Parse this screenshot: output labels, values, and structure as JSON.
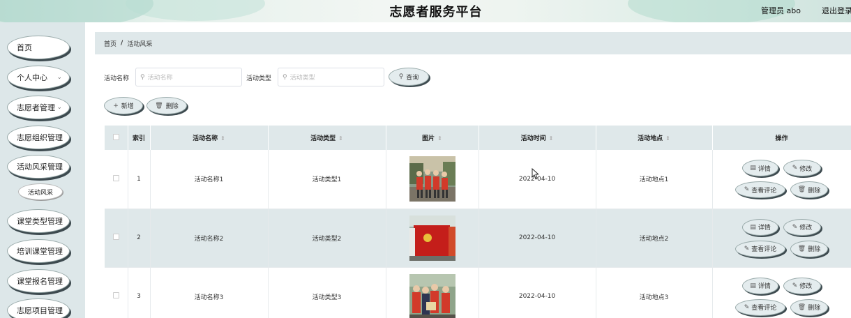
{
  "header": {
    "title": "志愿者服务平台",
    "admin": "管理员 abo",
    "logout": "退出登录"
  },
  "sidebar": {
    "items": [
      {
        "label": "首页",
        "chevron": false
      },
      {
        "label": "个人中心",
        "chevron": true
      },
      {
        "label": "志愿者管理",
        "chevron": true
      },
      {
        "label": "志愿组织管理",
        "chevron": false
      },
      {
        "label": "活动风采管理",
        "chevron": false
      },
      {
        "label": "课堂类型管理",
        "chevron": false
      },
      {
        "label": "培训课堂管理",
        "chevron": false
      },
      {
        "label": "课堂报名管理",
        "chevron": false
      },
      {
        "label": "志愿项目管理",
        "chevron": false
      }
    ],
    "sub_item": "活动风采"
  },
  "breadcrumb": {
    "home": "首页",
    "separator": "/",
    "current": "活动风采"
  },
  "search": {
    "name_label": "活动名称",
    "name_placeholder": "活动名称",
    "type_label": "活动类型",
    "type_placeholder": "活动类型",
    "query_button": "查询"
  },
  "toolbar": {
    "add_button": "新增",
    "delete_button": "删除"
  },
  "table": {
    "headers": {
      "index": "索引",
      "name": "活动名称",
      "type": "活动类型",
      "image": "图片",
      "time": "活动时间",
      "place": "活动地点",
      "actions": "操作"
    },
    "rows": [
      {
        "index": "1",
        "name": "活动名称1",
        "type": "活动类型1",
        "time": "2022-04-10",
        "place": "活动地点1"
      },
      {
        "index": "2",
        "name": "活动名称2",
        "type": "活动类型2",
        "time": "2022-04-10",
        "place": "活动地点2"
      },
      {
        "index": "3",
        "name": "活动名称3",
        "type": "活动类型3",
        "time": "2022-04-10",
        "place": "活动地点3"
      }
    ],
    "actions": {
      "detail": "详情",
      "edit": "修改",
      "comments": "查看评论",
      "delete": "删除"
    }
  }
}
